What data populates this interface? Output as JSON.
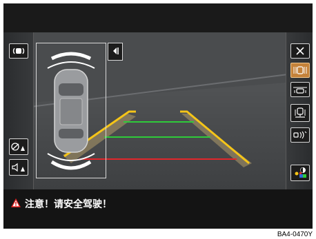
{
  "warning": {
    "text": "注意！请安全驾驶！"
  },
  "caption": "BA4-0470Y",
  "left_buttons": [
    {
      "name": "park-sensor-sound-button",
      "icon": "proximity-sound-icon"
    },
    {
      "name": "drive-assist-warning-button",
      "icon": "steering-wheel-warning-icon"
    },
    {
      "name": "speaker-warning-button",
      "icon": "speaker-warning-icon"
    }
  ],
  "right_buttons": [
    {
      "name": "close-button",
      "icon": "close-icon"
    },
    {
      "name": "rear-view-mode-button",
      "icon": "rear-view-mode-icon",
      "active": true
    },
    {
      "name": "cross-traffic-mode-button",
      "icon": "cross-traffic-icon"
    },
    {
      "name": "trailer-mode-button",
      "icon": "trailer-icon"
    },
    {
      "name": "parking-sensor-button",
      "icon": "parking-sensor-icon"
    },
    {
      "name": "display-settings-button",
      "icon": "color-settings-icon"
    }
  ],
  "colors": {
    "active_button": "#c4823a",
    "guide_yellow": "#f5c518",
    "guide_green": "#2ecc3a",
    "guide_red": "#e3262b",
    "warning_red": "#e02020"
  }
}
